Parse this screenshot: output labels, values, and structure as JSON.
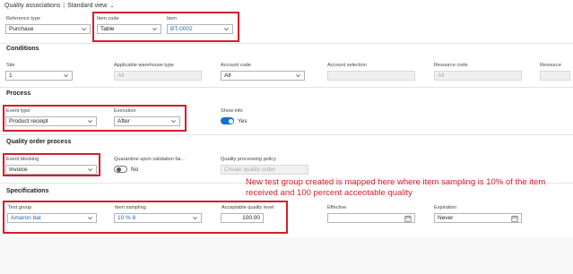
{
  "header": {
    "title": "Quality associations",
    "separator": "|",
    "view_label": "Standard view"
  },
  "top": {
    "reference_type": {
      "label": "Reference type",
      "value": "Purchase"
    },
    "item_code": {
      "label": "Item code",
      "value": "Table"
    },
    "item": {
      "label": "Item",
      "value": "BT-0002"
    }
  },
  "conditions": {
    "heading": "Conditions",
    "site": {
      "label": "Site",
      "value": "1"
    },
    "applicable_warehouse_type": {
      "label": "Applicable warehouse type",
      "value": "All"
    },
    "account_code": {
      "label": "Account code",
      "value": "All"
    },
    "account_selection": {
      "label": "Account selection",
      "value": ""
    },
    "resource_code": {
      "label": "Resource code",
      "value": "All"
    },
    "resource": {
      "label": "Resource",
      "value": ""
    }
  },
  "process": {
    "heading": "Process",
    "event_type": {
      "label": "Event type",
      "value": "Product receipt"
    },
    "execution": {
      "label": "Execution",
      "value": "After"
    },
    "show_info": {
      "label": "Show info",
      "value": "Yes",
      "on": true
    }
  },
  "quality_order_process": {
    "heading": "Quality order process",
    "event_blocking": {
      "label": "Event blocking",
      "value": "Invoice"
    },
    "quarantine": {
      "label": "Quarantine upon validation fai...",
      "value": "No",
      "on": false
    },
    "quality_processing_policy": {
      "label": "Quality processing policy",
      "placeholder": "Create quality order"
    }
  },
  "specifications": {
    "heading": "Specifications",
    "test_group": {
      "label": "Test group",
      "value": "Amaron bat"
    },
    "item_sampling": {
      "label": "Item sampling",
      "value": "10 % 8"
    },
    "acceptable_quality_level": {
      "label": "Acceptable quality level",
      "value": "100.00"
    },
    "effective": {
      "label": "Effective",
      "value": ""
    },
    "expiration": {
      "label": "Expiration",
      "value": "Never"
    }
  },
  "annotation": {
    "text": "New test group created is mapped here where item sampling is 10% of the item received and 100 percent acceotable quality"
  },
  "colors": {
    "highlight": "#d21f2a",
    "link": "#2266b8",
    "toggle_on": "#1a6fc9"
  }
}
